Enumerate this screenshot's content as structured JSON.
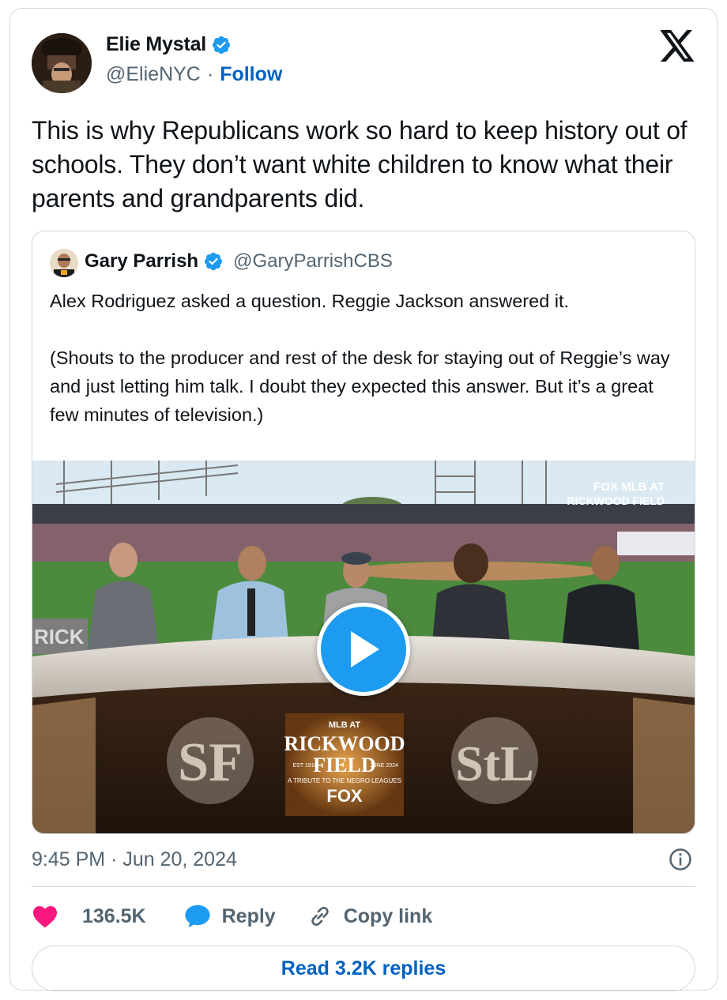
{
  "tweet": {
    "author_name": "Elie Mystal",
    "author_handle": "@ElieNYC",
    "separator": "·",
    "follow_label": "Follow",
    "text": "This is why Republicans work so hard to keep history out of schools. They don’t want white children to know what their parents and grandparents did.",
    "timestamp": "9:45 PM · Jun 20, 2024"
  },
  "quote": {
    "author_name": "Gary Parrish",
    "author_handle": "@GaryParrishCBS",
    "paragraphs": [
      "Alex Rodriguez asked a question. Reggie Jackson answered it.",
      "(Shouts to the producer and rest of the desk for staying out of Reggie’s way and just letting him talk. I doubt they expected this answer. But it’s a great few minutes of television.)"
    ],
    "video": {
      "broadcast_bug_line1": "FOX MLB AT",
      "broadcast_bug_line2": "RICKWOOD FIELD",
      "desk_logo_top": "MLB AT",
      "desk_logo_main1": "RICKWOOD",
      "desk_logo_main2": "FIELD",
      "desk_logo_est": "EST 1910",
      "desk_logo_date": "JUNE 2024",
      "desk_logo_tribute": "A TRIBUTE TO THE NEGRO LEAGUES",
      "desk_logo_network": "FOX",
      "left_sign": "RICK"
    }
  },
  "actions": {
    "like_count": "136.5K",
    "reply_label": "Reply",
    "copy_link_label": "Copy link",
    "read_replies_label": "Read 3.2K replies"
  },
  "colors": {
    "link_blue": "#0061c2",
    "verified_blue": "#1d9bf0",
    "like_pink": "#f91880",
    "muted_gray": "#536471",
    "border": "#cfd9de"
  },
  "icons": [
    "verified-badge-icon",
    "x-logo-icon",
    "play-icon",
    "info-icon",
    "heart-icon",
    "reply-bubble-icon",
    "link-icon"
  ]
}
